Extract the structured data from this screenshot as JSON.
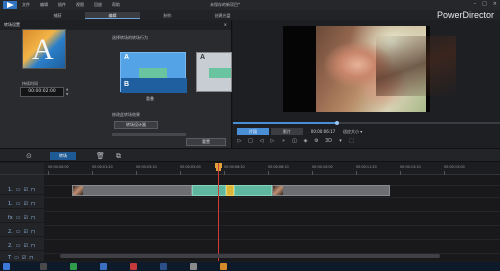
{
  "menu": {
    "items": [
      "文件",
      "编辑",
      "插件",
      "视图",
      "回放",
      "帮助"
    ]
  },
  "document_title": "未保存的新项目*",
  "brand": "PowerDirector",
  "modes": {
    "tabs": [
      "捕获",
      "编辑",
      "制作",
      "创建光盘"
    ],
    "active": 1
  },
  "room": {
    "title": "转场设置",
    "duration_label": "持续时间",
    "duration": "00:00:02:00",
    "select_label": "选择转场的转场行为",
    "option1_caption": "重叠",
    "modify_label": "修改此转场效果",
    "designer_button": "转场设计器",
    "reset_button": "重置"
  },
  "viewer": {
    "clip_label": "片段",
    "movie_label": "影片",
    "timecode": "00:00:06:17",
    "ratio_label": "适应大小",
    "scrub_progress": 0.39,
    "zoom_label": "3D"
  },
  "timeline": {
    "room_button": "转场",
    "ruler_labels": [
      "00:00:00:00",
      "00:00:01:20",
      "00:00:03:10",
      "00:00:05:00",
      "00:00:06:20",
      "00:00:08:10",
      "00:00:10:00",
      "00:00:11:20",
      "00:00:13:10",
      "00:00:15:00"
    ],
    "track_labels": [
      "1.",
      "1.",
      "fx",
      "2.",
      "2.",
      "T"
    ]
  },
  "colors": {
    "accent": "#4a8fd6",
    "playhead": "#d03b3b",
    "transition": "#5fb7a0"
  }
}
